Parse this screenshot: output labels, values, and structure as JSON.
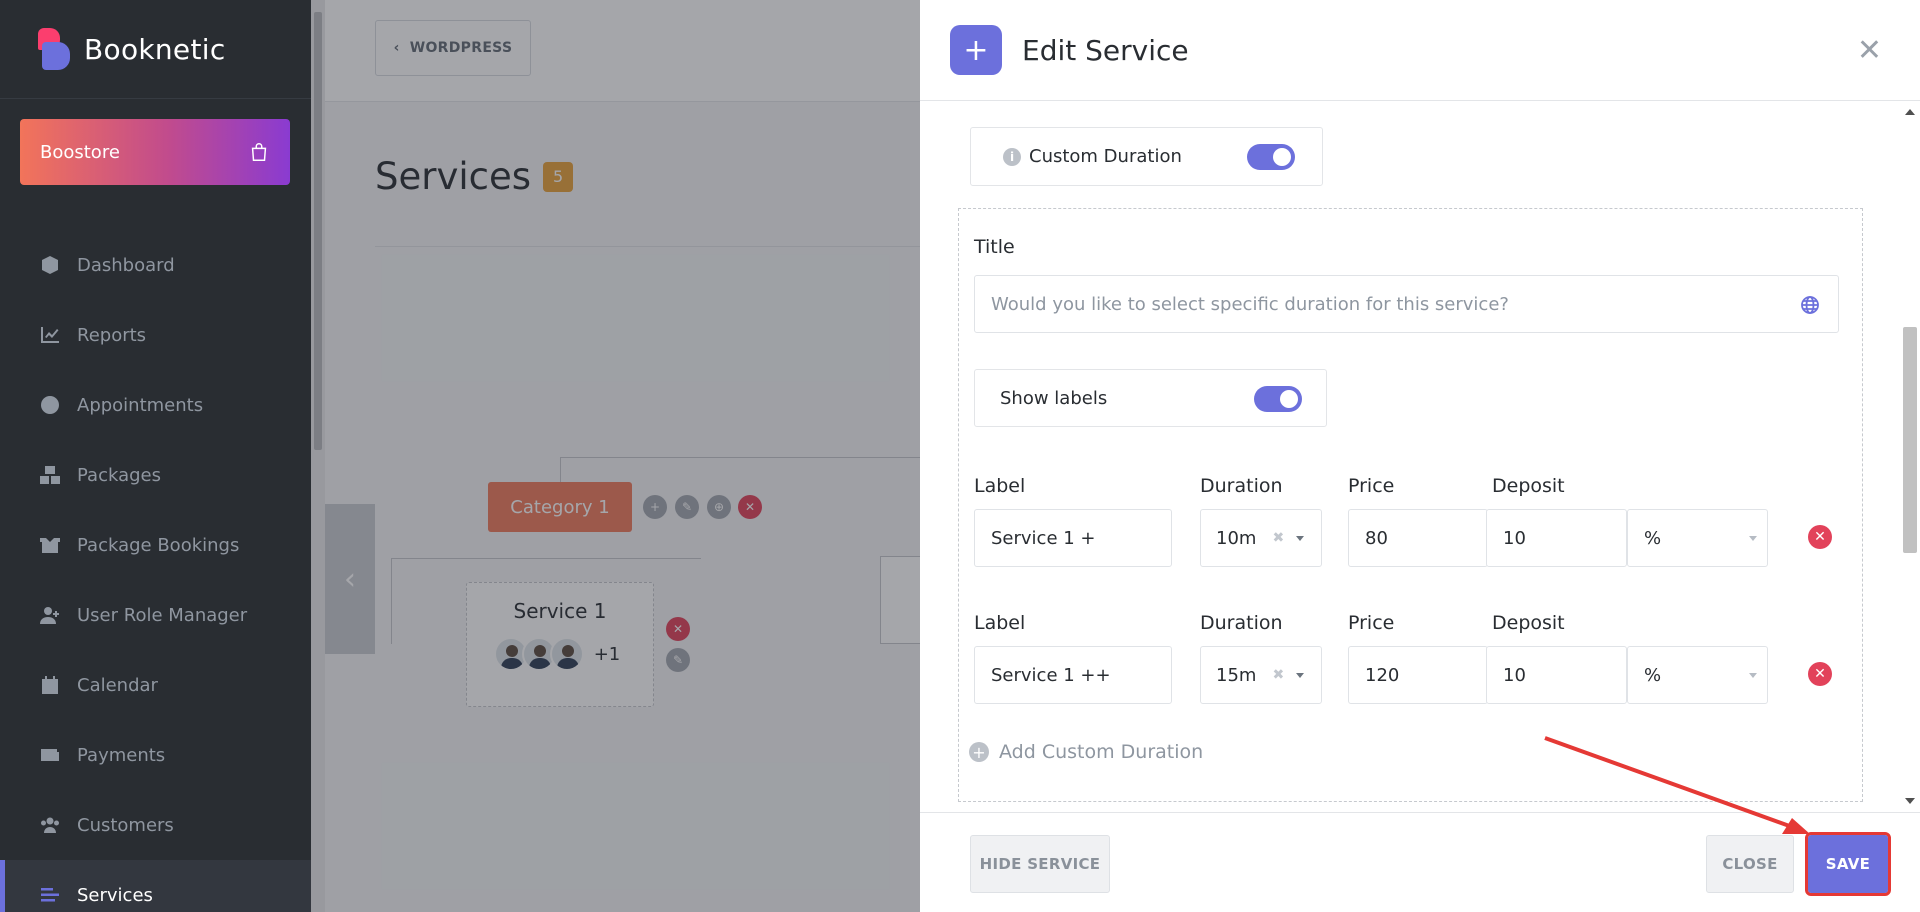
{
  "brand": {
    "name": "Booknetic"
  },
  "boostore": {
    "label": "Boostore",
    "icon": "shopping-bag-icon"
  },
  "sidebar": {
    "items": [
      {
        "label": "Dashboard",
        "icon": "cube-icon"
      },
      {
        "label": "Reports",
        "icon": "chart-line-icon"
      },
      {
        "label": "Appointments",
        "icon": "clock-icon"
      },
      {
        "label": "Packages",
        "icon": "boxes-icon"
      },
      {
        "label": "Package Bookings",
        "icon": "box-open-icon"
      },
      {
        "label": "User Role Manager",
        "icon": "user-plus-icon"
      },
      {
        "label": "Calendar",
        "icon": "calendar-icon"
      },
      {
        "label": "Payments",
        "icon": "wallet-icon"
      },
      {
        "label": "Customers",
        "icon": "users-icon"
      },
      {
        "label": "Services",
        "icon": "list-icon",
        "active": true
      }
    ]
  },
  "main": {
    "back_label": "WORDPRESS",
    "page_title": "Services",
    "services_count": "5",
    "category": "Category 1",
    "service": {
      "name": "Service 1",
      "more_staff": "+1"
    }
  },
  "panel": {
    "title": "Edit Service",
    "custom_duration_label": "Custom Duration",
    "custom_duration_on": true,
    "title_label": "Title",
    "title_placeholder": "Would you like to select specific duration for this service?",
    "show_labels_label": "Show labels",
    "show_labels_on": true,
    "col_label": "Label",
    "col_duration": "Duration",
    "col_price": "Price",
    "col_deposit": "Deposit",
    "rows": [
      {
        "label": "Service 1 +",
        "duration": "10m",
        "price": "80",
        "deposit": "10",
        "deposit_type": "%"
      },
      {
        "label": "Service 1 ++",
        "duration": "15m",
        "price": "120",
        "deposit": "10",
        "deposit_type": "%"
      }
    ],
    "add_custom_duration": "Add Custom Duration",
    "footer": {
      "hide_service": "HIDE SERVICE",
      "close": "CLOSE",
      "save": "SAVE"
    }
  },
  "colors": {
    "accent": "#6c70dc",
    "danger": "#e2425a",
    "category": "#f07a5c",
    "badge": "#e8a23a",
    "annotation": "#e53935"
  }
}
